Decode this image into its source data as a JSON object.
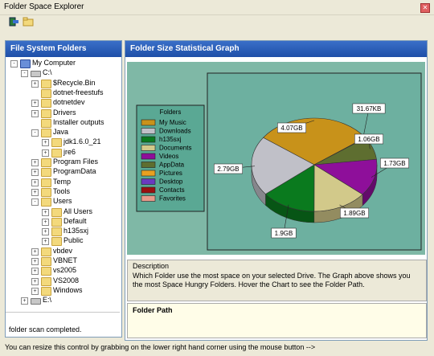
{
  "window": {
    "title": "Folder Space Explorer"
  },
  "left_panel": {
    "header": "File System Folders",
    "tree": [
      {
        "label": "My Computer",
        "depth": 0,
        "expander": "-",
        "icon": "computer"
      },
      {
        "label": "C:\\",
        "depth": 1,
        "expander": "-",
        "icon": "drive"
      },
      {
        "label": "$Recycle.Bin",
        "depth": 2,
        "expander": "+",
        "icon": "folder"
      },
      {
        "label": "dotnet-freestufs",
        "depth": 2,
        "expander": "",
        "icon": "folder"
      },
      {
        "label": "dotnetdev",
        "depth": 2,
        "expander": "+",
        "icon": "folder"
      },
      {
        "label": "Drivers",
        "depth": 2,
        "expander": "+",
        "icon": "folder"
      },
      {
        "label": "Installer outputs",
        "depth": 2,
        "expander": "",
        "icon": "folder"
      },
      {
        "label": "Java",
        "depth": 2,
        "expander": "-",
        "icon": "folder"
      },
      {
        "label": "jdk1.6.0_21",
        "depth": 3,
        "expander": "+",
        "icon": "folder"
      },
      {
        "label": "jre6",
        "depth": 3,
        "expander": "+",
        "icon": "folder"
      },
      {
        "label": "Program Files",
        "depth": 2,
        "expander": "+",
        "icon": "folder"
      },
      {
        "label": "ProgramData",
        "depth": 2,
        "expander": "+",
        "icon": "folder"
      },
      {
        "label": "Temp",
        "depth": 2,
        "expander": "+",
        "icon": "folder"
      },
      {
        "label": "Tools",
        "depth": 2,
        "expander": "+",
        "icon": "folder"
      },
      {
        "label": "Users",
        "depth": 2,
        "expander": "-",
        "icon": "folder"
      },
      {
        "label": "All Users",
        "depth": 3,
        "expander": "+",
        "icon": "folder"
      },
      {
        "label": "Default",
        "depth": 3,
        "expander": "+",
        "icon": "folder"
      },
      {
        "label": "h135sxj",
        "depth": 3,
        "expander": "+",
        "icon": "folder-search"
      },
      {
        "label": "Public",
        "depth": 3,
        "expander": "+",
        "icon": "folder"
      },
      {
        "label": "vbdev",
        "depth": 2,
        "expander": "+",
        "icon": "folder"
      },
      {
        "label": "VBNET",
        "depth": 2,
        "expander": "+",
        "icon": "folder"
      },
      {
        "label": "vs2005",
        "depth": 2,
        "expander": "+",
        "icon": "folder"
      },
      {
        "label": "VS2008",
        "depth": 2,
        "expander": "+",
        "icon": "folder"
      },
      {
        "label": "Windows",
        "depth": 2,
        "expander": "+",
        "icon": "folder"
      },
      {
        "label": "E:\\",
        "depth": 1,
        "expander": "+",
        "icon": "drive"
      }
    ],
    "status": "folder scan completed."
  },
  "right_panel": {
    "header": "Folder Size Statistical Graph",
    "description_title": "Description",
    "description_text": "Which Folder use the most space on your selected Drive. The Graph above shows you the most Space Hungry Folders. Hover the Chart to see the Folder Path.",
    "folder_path_title": "Folder Path"
  },
  "bottom_status": "You can resize this control by grabbing on the lower right hand corner using the mouse button -->",
  "chart_data": {
    "type": "pie",
    "legend_title": "Folders",
    "legend_placement": "left",
    "legend": [
      {
        "name": "My Music",
        "color": "#c8921a"
      },
      {
        "name": "Downloads",
        "color": "#c0c0c8"
      },
      {
        "name": "h135sxj",
        "color": "#0a7a1e"
      },
      {
        "name": "Documents",
        "color": "#d2c98a"
      },
      {
        "name": "Videos",
        "color": "#8e0f9a"
      },
      {
        "name": "AppData",
        "color": "#5e6e30"
      },
      {
        "name": "Pictures",
        "color": "#e8a020"
      },
      {
        "name": "Desktop",
        "color": "#6a3ac0"
      },
      {
        "name": "Contacts",
        "color": "#9a1010"
      },
      {
        "name": "Favorites",
        "color": "#e89a8a"
      }
    ],
    "slices": [
      {
        "name": "My Music",
        "label": "4.07GB",
        "value_gb": 4.07,
        "color": "#c8921a"
      },
      {
        "name": "Pictures",
        "label": "31.67KB",
        "value_gb": 0.02,
        "color": "#e8a020"
      },
      {
        "name": "AppData",
        "label": "1.06GB",
        "value_gb": 1.06,
        "color": "#5e6e30"
      },
      {
        "name": "Videos",
        "label": "1.73GB",
        "value_gb": 1.73,
        "color": "#8e0f9a"
      },
      {
        "name": "Documents",
        "label": "1.89GB",
        "value_gb": 1.89,
        "color": "#d2c98a"
      },
      {
        "name": "h135sxj",
        "label": "1.9GB",
        "value_gb": 1.9,
        "color": "#0a7a1e"
      },
      {
        "name": "Downloads",
        "label": "2.79GB",
        "value_gb": 2.79,
        "color": "#c0c0c8"
      }
    ]
  }
}
